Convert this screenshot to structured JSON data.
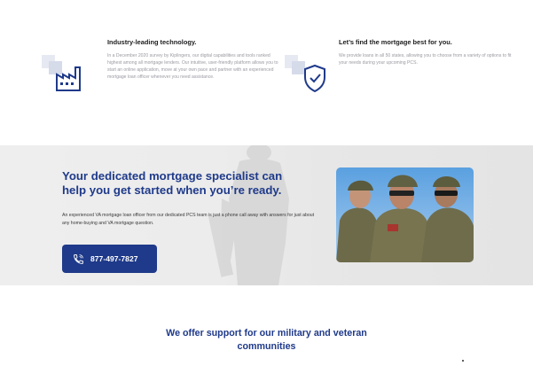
{
  "features": [
    {
      "title": "Industry-leading technology.",
      "body": "In a December 2020 survey by Kiplingers, our digital capabilities and tools ranked highest among all mortgage lenders. Our intuitive, user-friendly platform allows you to start an online application, move at your own pace and partner with an experienced mortgage loan officer whenever you need assistance.",
      "icon": "factory-icon"
    },
    {
      "title": "Let’s find the mortgage best for you.",
      "body": "We provide loans in all 50 states, allowing you to choose from a variety of options to fit your needs during your upcoming PCS.",
      "icon": "shield-check-icon"
    }
  ],
  "banner": {
    "heading_line1": "Your dedicated mortgage specialist can",
    "heading_line2": "help you get started when you’re ready.",
    "text": "An experienced VA mortgage loan officer from our dedicated PCS team is just a phone call away with answers for just about any home-buying and VA mortgage question.",
    "phone": "877-497-7827",
    "phone_icon": "phone-icon"
  },
  "support": {
    "heading_line1": "We offer support for our military and veteran",
    "heading_line2": "communities"
  },
  "colors": {
    "brand_blue": "#1f3a8a",
    "icon_square": "#dfe3ef"
  }
}
